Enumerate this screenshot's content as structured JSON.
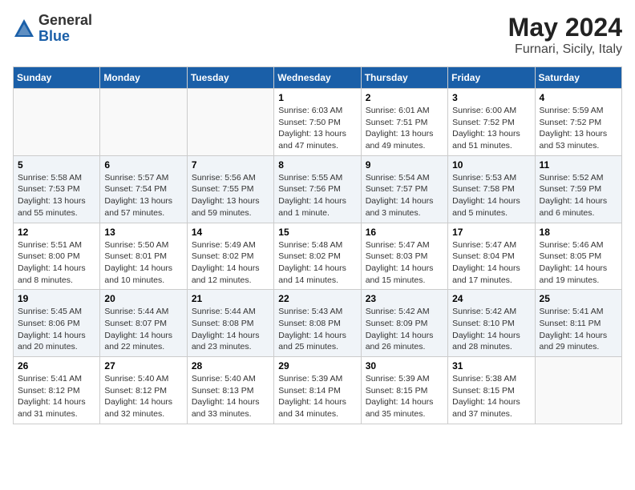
{
  "logo": {
    "general": "General",
    "blue": "Blue"
  },
  "header": {
    "month": "May 2024",
    "location": "Furnari, Sicily, Italy"
  },
  "weekdays": [
    "Sunday",
    "Monday",
    "Tuesday",
    "Wednesday",
    "Thursday",
    "Friday",
    "Saturday"
  ],
  "weeks": [
    [
      {
        "day": "",
        "info": ""
      },
      {
        "day": "",
        "info": ""
      },
      {
        "day": "",
        "info": ""
      },
      {
        "day": "1",
        "info": "Sunrise: 6:03 AM\nSunset: 7:50 PM\nDaylight: 13 hours and 47 minutes."
      },
      {
        "day": "2",
        "info": "Sunrise: 6:01 AM\nSunset: 7:51 PM\nDaylight: 13 hours and 49 minutes."
      },
      {
        "day": "3",
        "info": "Sunrise: 6:00 AM\nSunset: 7:52 PM\nDaylight: 13 hours and 51 minutes."
      },
      {
        "day": "4",
        "info": "Sunrise: 5:59 AM\nSunset: 7:52 PM\nDaylight: 13 hours and 53 minutes."
      }
    ],
    [
      {
        "day": "5",
        "info": "Sunrise: 5:58 AM\nSunset: 7:53 PM\nDaylight: 13 hours and 55 minutes."
      },
      {
        "day": "6",
        "info": "Sunrise: 5:57 AM\nSunset: 7:54 PM\nDaylight: 13 hours and 57 minutes."
      },
      {
        "day": "7",
        "info": "Sunrise: 5:56 AM\nSunset: 7:55 PM\nDaylight: 13 hours and 59 minutes."
      },
      {
        "day": "8",
        "info": "Sunrise: 5:55 AM\nSunset: 7:56 PM\nDaylight: 14 hours and 1 minute."
      },
      {
        "day": "9",
        "info": "Sunrise: 5:54 AM\nSunset: 7:57 PM\nDaylight: 14 hours and 3 minutes."
      },
      {
        "day": "10",
        "info": "Sunrise: 5:53 AM\nSunset: 7:58 PM\nDaylight: 14 hours and 5 minutes."
      },
      {
        "day": "11",
        "info": "Sunrise: 5:52 AM\nSunset: 7:59 PM\nDaylight: 14 hours and 6 minutes."
      }
    ],
    [
      {
        "day": "12",
        "info": "Sunrise: 5:51 AM\nSunset: 8:00 PM\nDaylight: 14 hours and 8 minutes."
      },
      {
        "day": "13",
        "info": "Sunrise: 5:50 AM\nSunset: 8:01 PM\nDaylight: 14 hours and 10 minutes."
      },
      {
        "day": "14",
        "info": "Sunrise: 5:49 AM\nSunset: 8:02 PM\nDaylight: 14 hours and 12 minutes."
      },
      {
        "day": "15",
        "info": "Sunrise: 5:48 AM\nSunset: 8:02 PM\nDaylight: 14 hours and 14 minutes."
      },
      {
        "day": "16",
        "info": "Sunrise: 5:47 AM\nSunset: 8:03 PM\nDaylight: 14 hours and 15 minutes."
      },
      {
        "day": "17",
        "info": "Sunrise: 5:47 AM\nSunset: 8:04 PM\nDaylight: 14 hours and 17 minutes."
      },
      {
        "day": "18",
        "info": "Sunrise: 5:46 AM\nSunset: 8:05 PM\nDaylight: 14 hours and 19 minutes."
      }
    ],
    [
      {
        "day": "19",
        "info": "Sunrise: 5:45 AM\nSunset: 8:06 PM\nDaylight: 14 hours and 20 minutes."
      },
      {
        "day": "20",
        "info": "Sunrise: 5:44 AM\nSunset: 8:07 PM\nDaylight: 14 hours and 22 minutes."
      },
      {
        "day": "21",
        "info": "Sunrise: 5:44 AM\nSunset: 8:08 PM\nDaylight: 14 hours and 23 minutes."
      },
      {
        "day": "22",
        "info": "Sunrise: 5:43 AM\nSunset: 8:08 PM\nDaylight: 14 hours and 25 minutes."
      },
      {
        "day": "23",
        "info": "Sunrise: 5:42 AM\nSunset: 8:09 PM\nDaylight: 14 hours and 26 minutes."
      },
      {
        "day": "24",
        "info": "Sunrise: 5:42 AM\nSunset: 8:10 PM\nDaylight: 14 hours and 28 minutes."
      },
      {
        "day": "25",
        "info": "Sunrise: 5:41 AM\nSunset: 8:11 PM\nDaylight: 14 hours and 29 minutes."
      }
    ],
    [
      {
        "day": "26",
        "info": "Sunrise: 5:41 AM\nSunset: 8:12 PM\nDaylight: 14 hours and 31 minutes."
      },
      {
        "day": "27",
        "info": "Sunrise: 5:40 AM\nSunset: 8:12 PM\nDaylight: 14 hours and 32 minutes."
      },
      {
        "day": "28",
        "info": "Sunrise: 5:40 AM\nSunset: 8:13 PM\nDaylight: 14 hours and 33 minutes."
      },
      {
        "day": "29",
        "info": "Sunrise: 5:39 AM\nSunset: 8:14 PM\nDaylight: 14 hours and 34 minutes."
      },
      {
        "day": "30",
        "info": "Sunrise: 5:39 AM\nSunset: 8:15 PM\nDaylight: 14 hours and 35 minutes."
      },
      {
        "day": "31",
        "info": "Sunrise: 5:38 AM\nSunset: 8:15 PM\nDaylight: 14 hours and 37 minutes."
      },
      {
        "day": "",
        "info": ""
      }
    ]
  ]
}
